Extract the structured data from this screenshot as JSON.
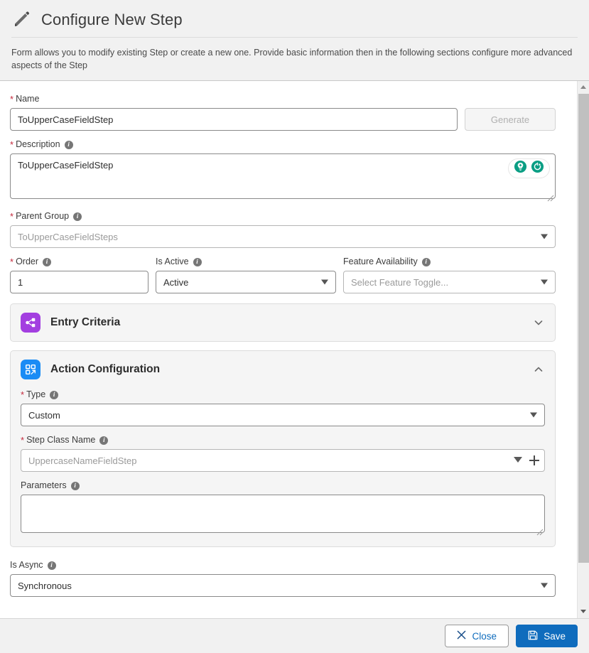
{
  "header": {
    "icon": "pencil-icon",
    "title": "Configure New Step",
    "subtitle": "Form allows you to modify existing Step or create a new one. Provide basic information then in the following sections configure more advanced aspects of the Step"
  },
  "form": {
    "name": {
      "label": "Name",
      "required": true,
      "value": "ToUpperCaseFieldStep",
      "generate_label": "Generate",
      "generate_disabled": true
    },
    "description": {
      "label": "Description",
      "required": true,
      "has_info": true,
      "value": "ToUpperCaseFieldStep",
      "ai_icons": [
        "lightbulb-icon",
        "regenerate-icon"
      ]
    },
    "parent_group": {
      "label": "Parent Group",
      "required": true,
      "has_info": true,
      "value": "ToUpperCaseFieldSteps",
      "is_placeholder": true
    },
    "order": {
      "label": "Order",
      "required": true,
      "has_info": true,
      "value": "1"
    },
    "is_active": {
      "label": "Is Active",
      "required": false,
      "has_info": true,
      "value": "Active"
    },
    "feature_availability": {
      "label": "Feature Availability",
      "required": false,
      "has_info": true,
      "value": "Select Feature Toggle...",
      "is_placeholder": true
    },
    "is_async": {
      "label": "Is Async",
      "required": false,
      "has_info": true,
      "value": "Synchronous"
    }
  },
  "sections": [
    {
      "id": "entry-criteria",
      "title": "Entry Criteria",
      "icon": "nodes-icon",
      "icon_color": "#a33fe0",
      "expanded": false,
      "chevron": "chevron-down-icon"
    },
    {
      "id": "action-configuration",
      "title": "Action Configuration",
      "icon": "action-grid-icon",
      "icon_color": "#1a8cf5",
      "expanded": true,
      "chevron": "chevron-up-icon"
    }
  ],
  "action_config": {
    "type": {
      "label": "Type",
      "required": true,
      "has_info": true,
      "value": "Custom"
    },
    "step_class_name": {
      "label": "Step Class Name",
      "required": true,
      "has_info": true,
      "value": "UppercaseNameFieldStep",
      "is_placeholder": true,
      "actions": [
        "chevron-down-icon",
        "plus-icon"
      ]
    },
    "parameters": {
      "label": "Parameters",
      "required": false,
      "has_info": true,
      "value": ""
    }
  },
  "footer": {
    "close_label": "Close",
    "close_icon": "close-x-icon",
    "save_label": "Save",
    "save_icon": "save-floppy-icon"
  },
  "colors": {
    "accent": "#0f6cbd",
    "required_star": "#c42a3d",
    "teal": "#0a9e84",
    "purple": "#a33fe0",
    "blue_icon": "#1a8cf5"
  },
  "scrollbar": {
    "up_arrow": "scroll-up-arrow",
    "down_arrow": "scroll-down-arrow",
    "thumb": "scroll-thumb"
  }
}
